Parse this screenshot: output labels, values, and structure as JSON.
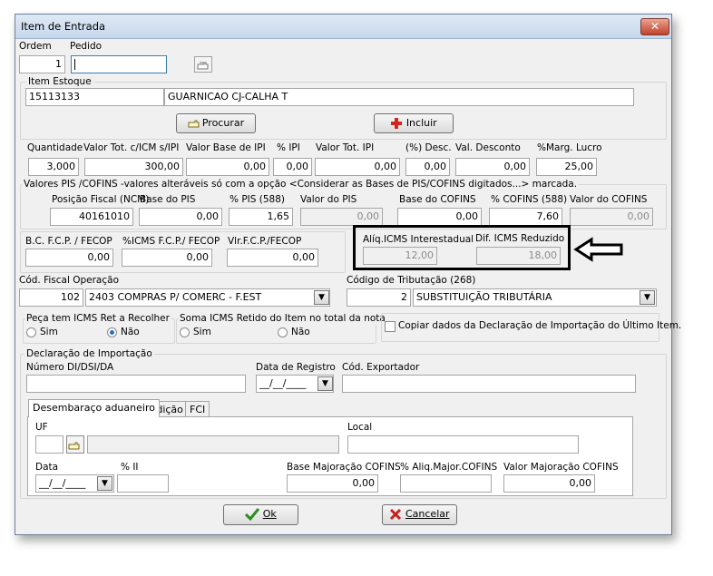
{
  "window": {
    "title": "Item de Entrada",
    "close_glyph": "✕"
  },
  "header": {
    "ordem_label": "Ordem",
    "ordem_value": "1",
    "pedido_label": "Pedido",
    "pedido_value": ""
  },
  "item_estoque": {
    "label": "Item Estoque",
    "code": "15113133",
    "description": "GUARNICAO CJ-CALHA T",
    "procurar_label": "Procurar",
    "incluir_label": "Incluir"
  },
  "valores": {
    "quantidade_label": "Quantidade",
    "quantidade": "3,000",
    "valor_tot_label": "Valor Tot. c/ICM s/IPI",
    "valor_tot": "300,00",
    "base_ipi_label": "Valor Base de IPI",
    "base_ipi": "0,00",
    "pct_ipi_label": "% IPI",
    "pct_ipi": "0,00",
    "valor_tot_ipi_label": "Valor Tot. IPI",
    "valor_tot_ipi": "0,00",
    "desc_label": "(%) Desc.",
    "desc": "0,00",
    "val_desconto_label": "Val. Desconto",
    "val_desconto": "0,00",
    "marg_lucro_label": "%Marg. Lucro",
    "marg_lucro": "25,00"
  },
  "pis_cofins": {
    "caption": "Valores PIS /COFINS -valores alteráveis só com a opção <Considerar as Bases de PIS/COFINS digitados...> marcada.",
    "ncm_label": "Posição Fiscal (NCM)",
    "ncm": "40161010",
    "base_pis_label": "Base do PIS",
    "base_pis": "0,00",
    "pct_pis_label": "% PIS (588)",
    "pct_pis": "1,65",
    "valor_pis_label": "Valor do PIS",
    "valor_pis": "0,00",
    "base_cofins_label": "Base do COFINS",
    "base_cofins": "0,00",
    "pct_cofins_label": "% COFINS (588)",
    "pct_cofins": "7,60",
    "valor_cofins_label": "Valor do COFINS",
    "valor_cofins": "0,00"
  },
  "fcp": {
    "bc_label": "B.C. F.C.P. / FECOP",
    "bc": "0,00",
    "pct_label": "%ICMS F.C.P./ FECOP",
    "pct": "0,00",
    "vlr_label": "Vlr.F.C.P./FECOP",
    "vlr": "0,00"
  },
  "icms_box": {
    "aliq_label": "Alíq.ICMS Interestadual",
    "aliq": "12,00",
    "dif_label": "Dif. ICMS Reduzido",
    "dif": "18,00"
  },
  "cfop": {
    "label": "Cód. Fiscal Operação",
    "code": "102",
    "description": "2403 COMPRAS P/ COMERC - F.EST"
  },
  "tributacao": {
    "label": "Código de Tributação (268)",
    "code": "2",
    "description": "SUBSTITUIÇÃO TRIBUTÁRIA"
  },
  "icms_ret": {
    "label": "Peça tem ICMS Ret a Recolher",
    "sim": "Sim",
    "nao": "Não",
    "selected": "Não"
  },
  "soma_icms": {
    "label": "Soma ICMS Retido do Item no total da nota",
    "sim": "Sim",
    "nao": "Não",
    "selected": "none"
  },
  "copiar_label": "Copiar dados da Declaração de Importação do Último Item.",
  "declaracao": {
    "title": "Declaração de Importação",
    "numero_label": "Número DI/DSI/DA",
    "numero": "",
    "data_registro_label": "Data de Registro",
    "data_registro": "__/__/____",
    "exportador_label": "Cód. Exportador",
    "exportador": "",
    "tabs": [
      "Desembaraço aduaneiro",
      "Adição",
      "FCI"
    ],
    "uf_label": "UF",
    "uf": "",
    "local_label": "Local",
    "local": "",
    "data_label": "Data",
    "data": "__/__/____",
    "pct_ii_label": "% II",
    "pct_ii": "",
    "base_maj_label": "Base Majoração COFINS",
    "base_maj": "0,00",
    "aliq_maj_label": "% Aliq.Major.COFINS",
    "aliq_maj": "",
    "valor_maj_label": "Valor Majoração COFINS",
    "valor_maj": "0,00"
  },
  "footer": {
    "ok_label": "Ok",
    "cancelar_label": "Cancelar"
  },
  "colors": {
    "title_bg": "#c6d7ec",
    "window_bg": "#f0f0f0",
    "close_red": "#c2412a",
    "ok_green": "#2e8b22",
    "cancel_red": "#c8201a",
    "incluir_red": "#d2261c"
  }
}
